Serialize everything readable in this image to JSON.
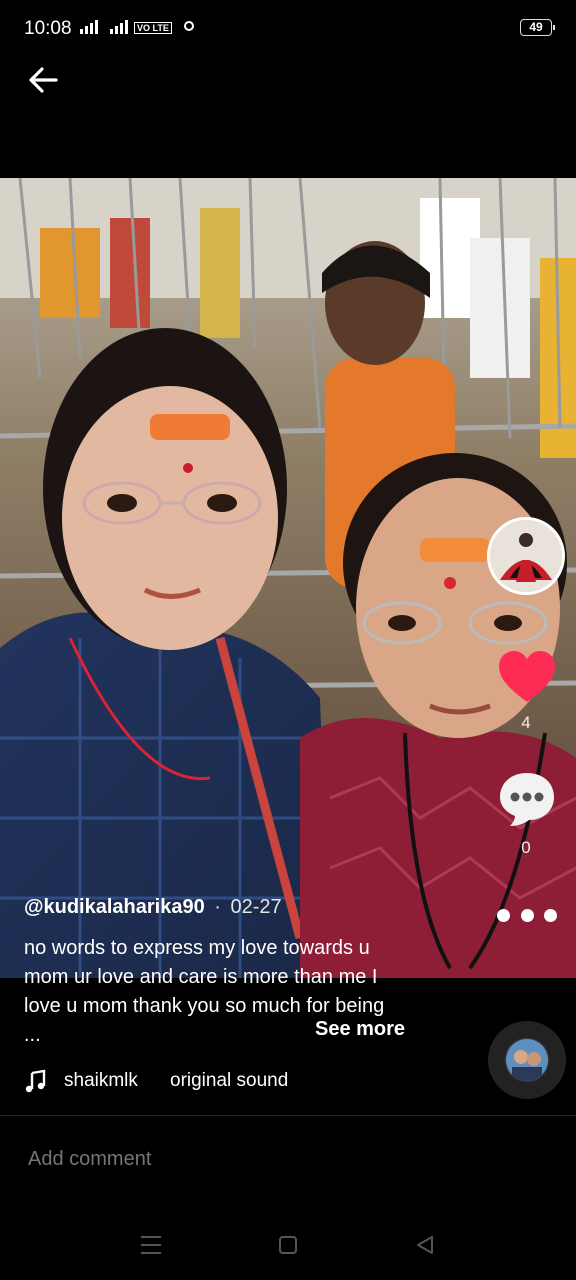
{
  "status_bar": {
    "time": "10:08",
    "network_label": "4G",
    "volte": "VO LTE",
    "battery": "49"
  },
  "post": {
    "username": "@kudikalaharika90",
    "separator": "·",
    "date": "02-27",
    "caption": "no words to express my love towards u mom ur love and care is more than me I love u mom thank you so much for being ...",
    "see_more": "See more",
    "likes": "4",
    "comments": "0",
    "liked": true,
    "like_color": "#fe2c55"
  },
  "music": {
    "artist": "shaikmlk",
    "title": "original sound"
  },
  "comment_box": {
    "placeholder": "Add comment"
  },
  "icons": {
    "back": "arrow-left-icon",
    "like": "heart-icon",
    "comment": "speech-bubble-icon",
    "more": "ellipsis-icon",
    "music": "music-note-icon",
    "nav_menu": "menu-icon",
    "nav_home": "square-icon",
    "nav_back": "triangle-back-icon"
  }
}
